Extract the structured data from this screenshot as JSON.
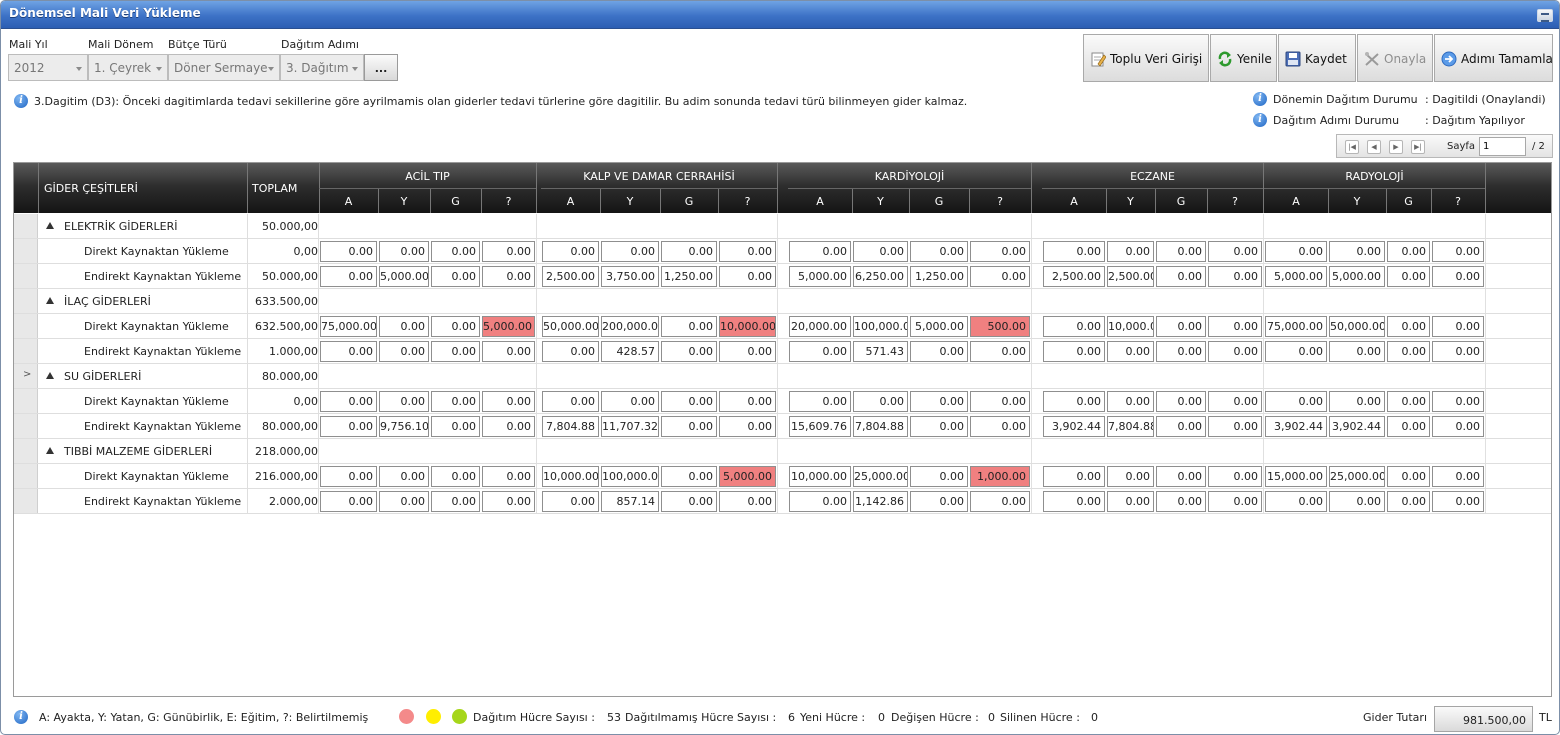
{
  "window": {
    "title": "Dönemsel Mali Veri Yükleme"
  },
  "filters": {
    "mali_yil": {
      "label": "Mali Yıl",
      "value": "2012"
    },
    "mali_donem": {
      "label": "Mali Dönem",
      "value": "1. Çeyrek"
    },
    "butce_turu": {
      "label": "Bütçe Türü",
      "value": "Döner Sermaye"
    },
    "dagitim_adimi": {
      "label": "Dağıtım Adımı",
      "value": "3. Dağıtım"
    },
    "more_label": "..."
  },
  "toolbar": {
    "toplu": "Toplu Veri Girişi",
    "yenile": "Yenile",
    "kaydet": "Kaydet",
    "onayla": "Onayla",
    "tamamla": "Adımı Tamamla"
  },
  "info": {
    "description": "3.Dagitim (D3): Önceki dagitimlarda tedavi sekillerine göre ayrilmamis olan giderler tedavi türlerine göre dagitilir. Bu adim sonunda tedavi türü bilinmeyen gider kalmaz.",
    "donem_label": "Dönemin Dağıtım Durumu",
    "donem_value": ": Dagitildi (Onaylandi)",
    "adim_label": "Dağıtım Adımı Durumu",
    "adim_value": ": Dağıtım Yapılıyor"
  },
  "pager": {
    "sayfa_label": "Sayfa",
    "current": "1",
    "total": "/ 2"
  },
  "grid": {
    "col_gider": "GİDER ÇEŞİTLERİ",
    "col_toplam": "TOPLAM",
    "sub_labels": [
      "A",
      "Y",
      "G",
      "?"
    ],
    "departments": [
      "ACİL TIP",
      "KALP VE DAMAR CERRAHİSİ",
      "KARDİYOLOJİ",
      "ECZANE",
      "RADYOLOJİ"
    ],
    "rows": [
      {
        "type": "group",
        "name": "ELEKTRİK GİDERLERİ",
        "total": "50.000,00",
        "pointer": false
      },
      {
        "type": "detail",
        "name": "Direkt Kaynaktan Yükleme",
        "total": "0,00",
        "values": [
          [
            "0.00",
            "0.00",
            "0.00",
            "0.00"
          ],
          [
            "0.00",
            "0.00",
            "0.00",
            "0.00"
          ],
          [
            "0.00",
            "0.00",
            "0.00",
            "0.00"
          ],
          [
            "0.00",
            "0.00",
            "0.00",
            "0.00"
          ],
          [
            "0.00",
            "0.00",
            "0.00",
            "0.00"
          ]
        ],
        "red": []
      },
      {
        "type": "detail",
        "name": "Endirekt Kaynaktan Yükleme",
        "total": "50.000,00",
        "values": [
          [
            "0.00",
            "5,000.00",
            "0.00",
            "0.00"
          ],
          [
            "2,500.00",
            "3,750.00",
            "1,250.00",
            "0.00"
          ],
          [
            "5,000.00",
            "6,250.00",
            "1,250.00",
            "0.00"
          ],
          [
            "2,500.00",
            "2,500.00",
            "0.00",
            "0.00"
          ],
          [
            "5,000.00",
            "5,000.00",
            "0.00",
            "0.00"
          ]
        ],
        "red": []
      },
      {
        "type": "group",
        "name": "İLAÇ GİDERLERİ",
        "total": "633.500,00",
        "pointer": false
      },
      {
        "type": "detail",
        "name": "Direkt Kaynaktan Yükleme",
        "total": "632.500,00",
        "values": [
          [
            "75,000.00",
            "0.00",
            "0.00",
            "5,000.00"
          ],
          [
            "50,000.00",
            "200,000.00",
            "0.00",
            "10,000.00"
          ],
          [
            "20,000.00",
            "100,000.00",
            "5,000.00",
            "500.00"
          ],
          [
            "0.00",
            "10,000.00",
            "0.00",
            "0.00"
          ],
          [
            "75,000.00",
            "50,000.00",
            "0.00",
            "0.00"
          ]
        ],
        "red": [
          [
            0,
            3
          ],
          [
            1,
            3
          ],
          [
            2,
            3
          ]
        ]
      },
      {
        "type": "detail",
        "name": "Endirekt Kaynaktan Yükleme",
        "total": "1.000,00",
        "values": [
          [
            "0.00",
            "0.00",
            "0.00",
            "0.00"
          ],
          [
            "0.00",
            "428.57",
            "0.00",
            "0.00"
          ],
          [
            "0.00",
            "571.43",
            "0.00",
            "0.00"
          ],
          [
            "0.00",
            "0.00",
            "0.00",
            "0.00"
          ],
          [
            "0.00",
            "0.00",
            "0.00",
            "0.00"
          ]
        ],
        "red": []
      },
      {
        "type": "group",
        "name": "SU GİDERLERİ",
        "total": "80.000,00",
        "pointer": true
      },
      {
        "type": "detail",
        "name": "Direkt Kaynaktan Yükleme",
        "total": "0,00",
        "values": [
          [
            "0.00",
            "0.00",
            "0.00",
            "0.00"
          ],
          [
            "0.00",
            "0.00",
            "0.00",
            "0.00"
          ],
          [
            "0.00",
            "0.00",
            "0.00",
            "0.00"
          ],
          [
            "0.00",
            "0.00",
            "0.00",
            "0.00"
          ],
          [
            "0.00",
            "0.00",
            "0.00",
            "0.00"
          ]
        ],
        "red": []
      },
      {
        "type": "detail",
        "name": "Endirekt Kaynaktan Yükleme",
        "total": "80.000,00",
        "values": [
          [
            "0.00",
            "9,756.10",
            "0.00",
            "0.00"
          ],
          [
            "7,804.88",
            "11,707.32",
            "0.00",
            "0.00"
          ],
          [
            "15,609.76",
            "7,804.88",
            "0.00",
            "0.00"
          ],
          [
            "3,902.44",
            "7,804.88",
            "0.00",
            "0.00"
          ],
          [
            "3,902.44",
            "3,902.44",
            "0.00",
            "0.00"
          ]
        ],
        "red": []
      },
      {
        "type": "group",
        "name": "TIBBİ MALZEME GİDERLERİ",
        "total": "218.000,00",
        "pointer": false
      },
      {
        "type": "detail",
        "name": "Direkt Kaynaktan Yükleme",
        "total": "216.000,00",
        "values": [
          [
            "0.00",
            "0.00",
            "0.00",
            "0.00"
          ],
          [
            "10,000.00",
            "100,000.00",
            "0.00",
            "5,000.00"
          ],
          [
            "10,000.00",
            "25,000.00",
            "0.00",
            "1,000.00"
          ],
          [
            "0.00",
            "0.00",
            "0.00",
            "0.00"
          ],
          [
            "15,000.00",
            "25,000.00",
            "0.00",
            "0.00"
          ]
        ],
        "red": [
          [
            1,
            3
          ],
          [
            2,
            3
          ]
        ]
      },
      {
        "type": "detail",
        "name": "Endirekt Kaynaktan Yükleme",
        "total": "2.000,00",
        "values": [
          [
            "0.00",
            "0.00",
            "0.00",
            "0.00"
          ],
          [
            "0.00",
            "857.14",
            "0.00",
            "0.00"
          ],
          [
            "0.00",
            "1,142.86",
            "0.00",
            "0.00"
          ],
          [
            "0.00",
            "0.00",
            "0.00",
            "0.00"
          ],
          [
            "0.00",
            "0.00",
            "0.00",
            "0.00"
          ]
        ],
        "red": []
      }
    ]
  },
  "footer": {
    "legend": "A: Ayakta, Y: Yatan, G: Günübirlik, E: Eğitim, ?: Belirtilmemiş",
    "dot_colors": [
      "#f48a8a",
      "#ffee00",
      "#a6d61a"
    ],
    "dagitim_hucre_label": "Dağıtım Hücre Sayısı :",
    "dagitim_hucre_value": "53",
    "dagitilmamis_label": "Dağıtılmamış Hücre Sayısı :",
    "dagitilmamis_value": "6",
    "yeni_label": "Yeni Hücre :",
    "yeni_value": "0",
    "degisen_label": "Değişen Hücre :",
    "degisen_value": "0",
    "silinen_label": "Silinen Hücre :",
    "silinen_value": "0",
    "gider_label": "Gider Tutarı",
    "gider_value": "981.500,00",
    "currency": "TL"
  }
}
